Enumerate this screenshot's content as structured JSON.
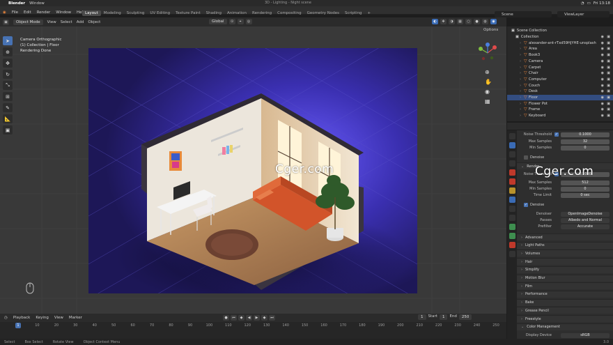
{
  "mac": {
    "app": "Blender",
    "menu": [
      "Window"
    ],
    "clock": "Fri 13:18"
  },
  "window_title": "3D - Lighting - Night scene",
  "menus": [
    "File",
    "Edit",
    "Render",
    "Window",
    "Help"
  ],
  "workspaces": [
    "Layout",
    "Modeling",
    "Sculpting",
    "UV Editing",
    "Texture Paint",
    "Shading",
    "Animation",
    "Rendering",
    "Compositing",
    "Geometry Nodes",
    "Scripting"
  ],
  "active_workspace": "Layout",
  "scene": "Scene",
  "view_layer": "ViewLayer",
  "viewport_header": {
    "mode": "Object Mode",
    "menus": [
      "View",
      "Select",
      "Add",
      "Object"
    ],
    "orientation": "Global",
    "options": "Options"
  },
  "viewport_info": [
    "Camera Orthographic",
    "(1) Collection | Floor",
    "Rendering Done"
  ],
  "outliner": {
    "root": "Scene Collection",
    "collection": "Collection",
    "items": [
      "alexander-ant-rTxd59HjYHE-unsplash",
      "Area",
      "Book3",
      "Camera",
      "Carpet",
      "Chair",
      "Computer",
      "Couch",
      "Desk",
      "Floor",
      "Flower Pot",
      "Frame",
      "Keyboard"
    ],
    "selected": "Floor"
  },
  "properties": {
    "noise_threshold_label": "Noise Threshold",
    "noise_threshold": "0.1000",
    "max_samples_label": "Max Samples",
    "max_samples": "32",
    "min_samples_label": "Min Samples",
    "min_samples": "0",
    "denoise_label": "Denoise",
    "render_label": "Render",
    "noise_label": "Noise Threshold",
    "render_max_samples": "512",
    "render_min_samples": "0",
    "time_limit_label": "Time Limit",
    "time_limit": "0 sec",
    "denoiser_label": "Denoiser",
    "denoiser": "OpenImageDenoise",
    "passes_label": "Passes",
    "passes": "Albedo and Normal",
    "prefilter_label": "Prefilter",
    "prefilter": "Accurate",
    "sections": [
      "Advanced",
      "Light Paths",
      "Volumes",
      "Hair",
      "Simplify",
      "Motion Blur",
      "Film",
      "Performance",
      "Bake",
      "Grease Pencil",
      "Freestyle",
      "Color Management"
    ],
    "display_device_label": "Display Device",
    "display_device": "sRGB"
  },
  "timeline": {
    "menus": [
      "Playback",
      "Keying",
      "View",
      "Marker"
    ],
    "current_frame": "1",
    "start_label": "Start",
    "start": "1",
    "end_label": "End",
    "end": "250",
    "ticks": [
      "1",
      "10",
      "20",
      "30",
      "40",
      "50",
      "60",
      "70",
      "80",
      "90",
      "100",
      "110",
      "120",
      "130",
      "140",
      "150",
      "160",
      "170",
      "180",
      "190",
      "200",
      "210",
      "220",
      "230",
      "240",
      "250"
    ]
  },
  "status": [
    "Select",
    "Box Select",
    "Rotate View",
    "Object Context Menu"
  ],
  "version": "3.0",
  "watermark": "Cger.com",
  "colors": {
    "accent": "#4772b3",
    "render_bg": "#201b5a",
    "wall": "#e9e3da",
    "couch": "#d2542a"
  }
}
